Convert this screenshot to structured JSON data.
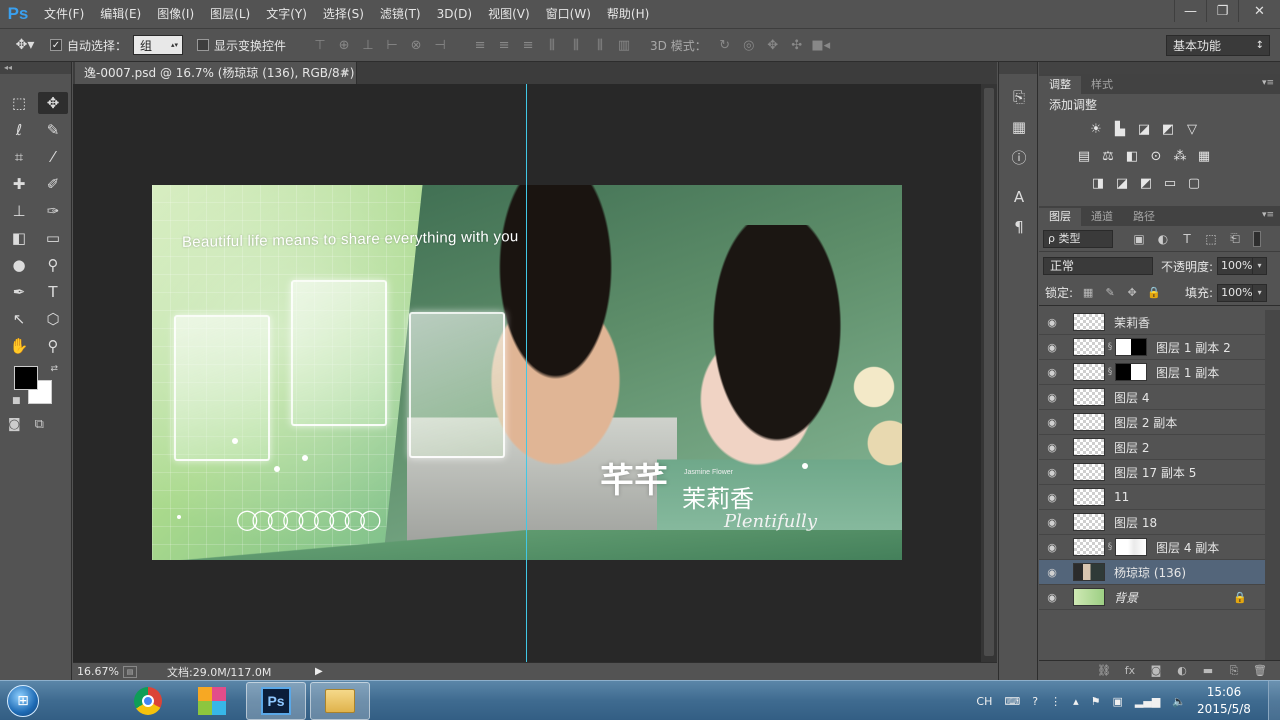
{
  "app": {
    "logo": "Ps"
  },
  "menu": [
    "文件(F)",
    "编辑(E)",
    "图像(I)",
    "图层(L)",
    "文字(Y)",
    "选择(S)",
    "滤镜(T)",
    "3D(D)",
    "视图(V)",
    "窗口(W)",
    "帮助(H)"
  ],
  "window_controls": {
    "minimize": "—",
    "restore": "❐",
    "close": "✕"
  },
  "options": {
    "tool_icon": "move-tool-icon",
    "auto_select_label": "自动选择：",
    "auto_select_checked": "✓",
    "auto_select_value": "组",
    "show_transform_label": "显示变换控件",
    "three_d_label": "3D 模式：",
    "workspace": "基本功能"
  },
  "document": {
    "tab_title": "逸-0007.psd @ 16.7% (杨琼琼 (136), RGB/8#) *",
    "close": "×"
  },
  "artwork": {
    "slogan": "Beautiful life means to share everything with you",
    "rings": "◯◯◯◯◯◯◯◯◯",
    "logo_cn_top": "芊芊",
    "logo_cn_bottom": "茉莉香",
    "logo_small": "Jasmine Flower",
    "logo_script": "Plentifully"
  },
  "status": {
    "zoom": "16.67%",
    "doc_info": "文档:29.0M/117.0M",
    "arrow": "▶"
  },
  "adjustments": {
    "tabs": [
      "调整",
      "样式"
    ],
    "title": "添加调整"
  },
  "layers_panel": {
    "tabs": [
      "图层",
      "通道",
      "路径"
    ],
    "filter": "ρ 类型",
    "blend_mode": "正常",
    "opacity_label": "不透明度:",
    "opacity": "100%",
    "lock_label": "锁定:",
    "fill_label": "填充:",
    "fill": "100%",
    "layers": [
      {
        "name": "茉莉香",
        "thumb": "checker",
        "mask": "",
        "selected": false
      },
      {
        "name": "图层 1 副本 2",
        "thumb": "checker",
        "mask": "wb",
        "selected": false
      },
      {
        "name": "图层 1 副本",
        "thumb": "checker",
        "mask": "bw",
        "selected": false
      },
      {
        "name": "图层 4",
        "thumb": "checker",
        "mask": "",
        "selected": false
      },
      {
        "name": "图层 2 副本",
        "thumb": "checker",
        "mask": "",
        "selected": false
      },
      {
        "name": "图层 2",
        "thumb": "checker",
        "mask": "",
        "selected": false
      },
      {
        "name": "图层 17 副本 5",
        "thumb": "checker",
        "mask": "",
        "selected": false
      },
      {
        "name": "11",
        "thumb": "checker",
        "mask": "",
        "selected": false
      },
      {
        "name": "图层 18",
        "thumb": "checker",
        "mask": "",
        "selected": false
      },
      {
        "name": "图层 4 副本",
        "thumb": "checker",
        "mask": "soft",
        "selected": false
      },
      {
        "name": "杨琼琼 (136)",
        "thumb": "photo",
        "mask": "",
        "selected": true
      },
      {
        "name": "背景",
        "thumb": "green",
        "mask": "",
        "selected": false,
        "locked": true
      }
    ]
  },
  "taskbar": {
    "ime": "CH",
    "time": "15:06",
    "date": "2015/5/8"
  },
  "colors": {
    "accent": "#3aa0ef",
    "guide": "#41c8e6",
    "selected_layer": "#53657a"
  }
}
